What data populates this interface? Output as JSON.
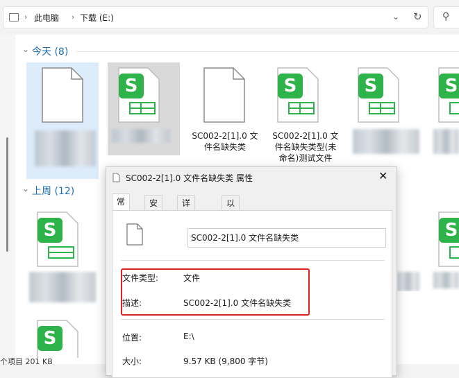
{
  "address_bar": {
    "crumbs": [
      "此电脑",
      "下载 (E:)"
    ]
  },
  "groups": {
    "today": "今天 (8)",
    "last_week": "上周 (12)"
  },
  "files": {
    "file3_name": "SC002-2[1].0 文件名缺失类",
    "file4_name": "SC002-2[1].0 文件名缺失类型(未命名)测试文件"
  },
  "file3_lines": [
    "SC002-2[1].0 文",
    "件名缺失类"
  ],
  "file4_lines": [
    "SC002-2[1].0 文",
    "件名缺失类型(未",
    "命名)测试文件"
  ],
  "status_bar": {
    "text": "个项目  201 KB"
  },
  "dialog": {
    "title": "SC002-2[1].0 文件名缺失类 属性",
    "tabs": [
      "常规",
      "安全",
      "详细信息",
      "以前的版本"
    ],
    "active_tab": "常规",
    "filename": "SC002-2[1].0 文件名缺失类",
    "file_type_label": "文件类型:",
    "file_type_value": "文件",
    "description_label": "描述:",
    "description_value": "SC002-2[1].0 文件名缺失类",
    "location_label": "位置:",
    "location_value": "E:\\",
    "size_label": "大小:",
    "size_value": "9.57 KB (9,800 字节)"
  },
  "colors": {
    "wps_green": "#2db34a",
    "highlight_red": "#e02020",
    "group_blue": "#1f6fb5"
  },
  "icons": [
    "chevron-right-icon",
    "chevron-down-icon",
    "refresh-icon",
    "search-icon",
    "close-icon",
    "blank-file-icon",
    "wps-spreadsheet-icon"
  ]
}
